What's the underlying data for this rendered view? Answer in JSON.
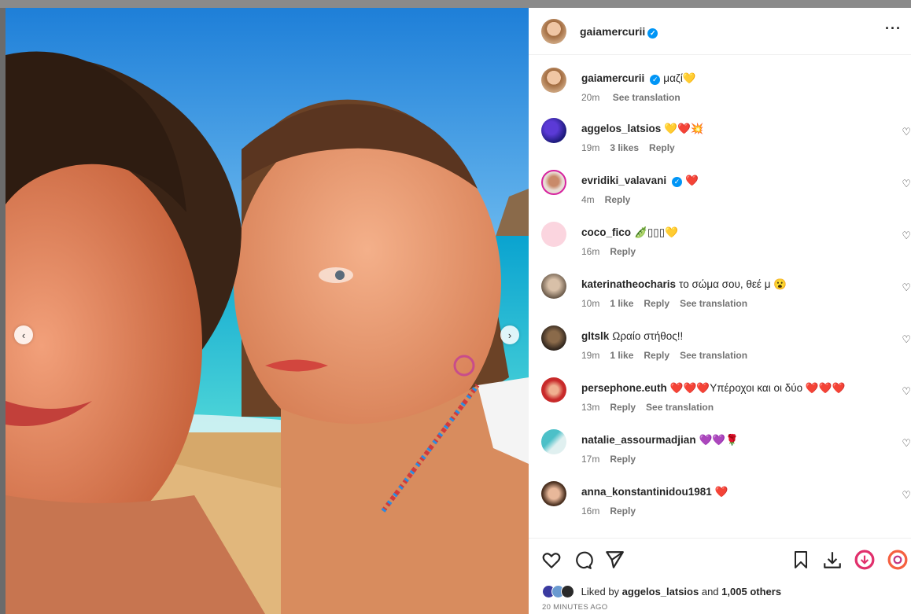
{
  "post": {
    "username": "gaiamercurii",
    "verified": true,
    "caption": "μαζί💛",
    "caption_time": "20m",
    "caption_translate": "See translation"
  },
  "comments": [
    {
      "user": "aggelos_latsios",
      "text": "💛❤️💥",
      "time": "19m",
      "likes": "3 likes",
      "reply": "Reply",
      "translate": ""
    },
    {
      "user": "evridiki_valavani",
      "verified": true,
      "text": "❤️",
      "time": "4m",
      "likes": "",
      "reply": "Reply",
      "translate": ""
    },
    {
      "user": "coco_fico",
      "text": "🫛▯▯▯💛",
      "time": "16m",
      "likes": "",
      "reply": "Reply",
      "translate": ""
    },
    {
      "user": "katerinatheocharis",
      "text": "το σώμα σου, θεέ μ 😮",
      "time": "10m",
      "likes": "1 like",
      "reply": "Reply",
      "translate": "See translation"
    },
    {
      "user": "gltslk",
      "text": "Ωραίο στήθος!!",
      "time": "19m",
      "likes": "1 like",
      "reply": "Reply",
      "translate": "See translation"
    },
    {
      "user": "persephone.euth",
      "text": "❤️❤️❤️Υπέροχοι και οι δύο ❤️❤️❤️",
      "time": "13m",
      "likes": "",
      "reply": "Reply",
      "translate": "See translation"
    },
    {
      "user": "natalie_assourmadjian",
      "text": "💜💜🌹",
      "time": "17m",
      "likes": "",
      "reply": "Reply",
      "translate": ""
    },
    {
      "user": "anna_konstantinidou1981",
      "text": "❤️",
      "time": "16m",
      "likes": "",
      "reply": "Reply",
      "translate": ""
    }
  ],
  "footer": {
    "liked_by_prefix": "Liked by",
    "liked_by_user": "aggelos_latsios",
    "liked_by_and": "and",
    "liked_by_count": "1,005 others",
    "timestamp": "20 MINUTES AGO"
  },
  "icons": {
    "more": "more-options-icon",
    "like": "heart-icon",
    "comment": "comment-icon",
    "share": "send-icon",
    "save": "bookmark-icon",
    "download": "download-icon"
  },
  "colors": {
    "verified": "#0095f6",
    "heart_red": "#e0245e",
    "meta_gray": "#737373"
  }
}
